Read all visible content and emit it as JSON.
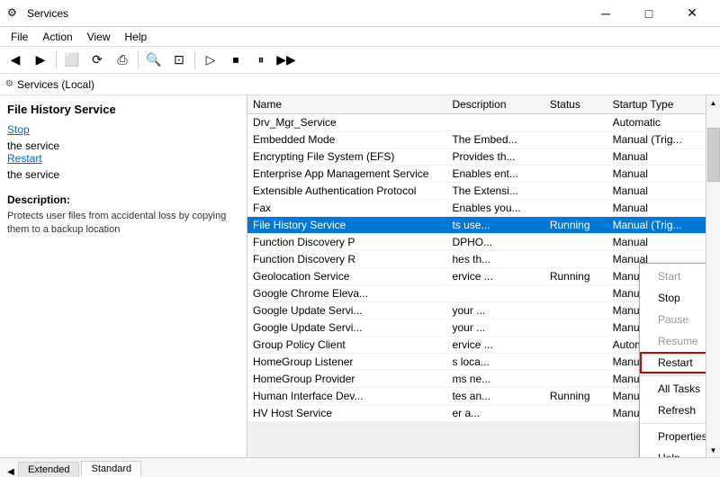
{
  "titleBar": {
    "icon": "⚙",
    "title": "Services",
    "minBtn": "─",
    "maxBtn": "□",
    "closeBtn": "✕"
  },
  "menuBar": {
    "items": [
      "File",
      "Action",
      "View",
      "Help"
    ]
  },
  "addressBar": {
    "label": "Services (Local)"
  },
  "leftPanel": {
    "title": "File History Service",
    "stopLink": "Stop",
    "stopSuffix": " the service",
    "restartLink": "Restart",
    "restartSuffix": " the service",
    "descLabel": "Description:",
    "description": "Protects user files from accidental loss by copying them to a backup location"
  },
  "tableHeaders": [
    "Name",
    "Description",
    "Status",
    "Startup Type"
  ],
  "services": [
    {
      "name": "Drv_Mgr_Service",
      "desc": "",
      "status": "",
      "startup": "Automatic"
    },
    {
      "name": "Embedded Mode",
      "desc": "The Embed...",
      "status": "",
      "startup": "Manual (Trig..."
    },
    {
      "name": "Encrypting File System (EFS)",
      "desc": "Provides th...",
      "status": "",
      "startup": "Manual"
    },
    {
      "name": "Enterprise App Management Service",
      "desc": "Enables ent...",
      "status": "",
      "startup": "Manual"
    },
    {
      "name": "Extensible Authentication Protocol",
      "desc": "The Extensi...",
      "status": "",
      "startup": "Manual"
    },
    {
      "name": "Fax",
      "desc": "Enables you...",
      "status": "",
      "startup": "Manual"
    },
    {
      "name": "File History Service",
      "desc": "ts use...",
      "status": "Running",
      "startup": "Manual (Trig...",
      "selected": true
    },
    {
      "name": "Function Discovery P",
      "desc": "DPHO...",
      "status": "",
      "startup": "Manual"
    },
    {
      "name": "Function Discovery R",
      "desc": "hes th...",
      "status": "",
      "startup": "Manual"
    },
    {
      "name": "Geolocation Service",
      "desc": "ervice ...",
      "status": "Running",
      "startup": "Manual (Trig..."
    },
    {
      "name": "Google Chrome Eleva...",
      "desc": "",
      "status": "",
      "startup": "Manual"
    },
    {
      "name": "Google Update Servi...",
      "desc": "your ...",
      "status": "",
      "startup": "Manual"
    },
    {
      "name": "Google Update Servi...",
      "desc": "your ...",
      "status": "",
      "startup": "Manual"
    },
    {
      "name": "Group Policy Client",
      "desc": "ervice ...",
      "status": "",
      "startup": "Automatic (T..."
    },
    {
      "name": "HomeGroup Listener",
      "desc": "s loca...",
      "status": "",
      "startup": "Manual"
    },
    {
      "name": "HomeGroup Provider",
      "desc": "ms ne...",
      "status": "",
      "startup": "Manual (Trig..."
    },
    {
      "name": "Human Interface Dev...",
      "desc": "tes an...",
      "status": "Running",
      "startup": "Manual"
    },
    {
      "name": "HV Host Service",
      "desc": "er a...",
      "status": "",
      "startup": "Manual (Trig..."
    }
  ],
  "contextMenu": {
    "items": [
      {
        "label": "Start",
        "disabled": true
      },
      {
        "label": "Stop",
        "disabled": false
      },
      {
        "label": "Pause",
        "disabled": true
      },
      {
        "label": "Resume",
        "disabled": true
      },
      {
        "label": "Restart",
        "highlighted": true
      },
      {
        "label": "All Tasks",
        "hasArrow": true
      },
      {
        "label": "Refresh"
      },
      {
        "label": "Properties"
      },
      {
        "label": "Help"
      }
    ]
  },
  "tabs": [
    {
      "label": "Extended",
      "active": false
    },
    {
      "label": "Standard",
      "active": true
    }
  ],
  "toolbar": {
    "buttons": [
      "◀",
      "▶",
      "⬜",
      "⟳",
      "⎙",
      "🔍",
      "⊡",
      "▷",
      "⏹",
      "⏸",
      "▶▶"
    ]
  }
}
